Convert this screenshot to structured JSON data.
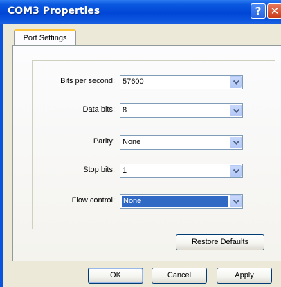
{
  "window": {
    "title": "COM3 Properties",
    "help_glyph": "?",
    "close_glyph": "✕"
  },
  "tabs": [
    {
      "label": "Port Settings",
      "active": true
    }
  ],
  "settings": [
    {
      "label": "Bits per second:",
      "value": "57600",
      "highlighted": false
    },
    {
      "label": "Data bits:",
      "value": "8",
      "highlighted": false
    },
    {
      "label": "Parity:",
      "value": "None",
      "highlighted": false
    },
    {
      "label": "Stop bits:",
      "value": "1",
      "highlighted": false
    },
    {
      "label": "Flow control:",
      "value": "None",
      "highlighted": true
    }
  ],
  "restore_label": "Restore Defaults",
  "footer": {
    "ok_label": "OK",
    "cancel_label": "Cancel",
    "apply_label": "Apply"
  },
  "colors": {
    "titlebar": "#0a54de",
    "selection": "#316ac5",
    "tab_accent": "#ffc83c"
  }
}
